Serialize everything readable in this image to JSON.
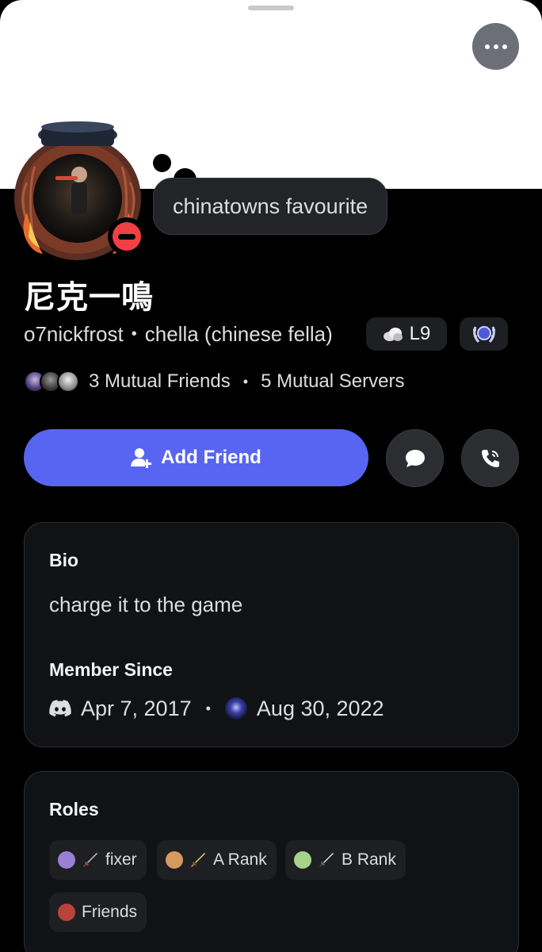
{
  "profile": {
    "display_name": "尼克一鳴",
    "username": "o7nickfrost",
    "pronouns": "chella (chinese fella)",
    "custom_status": "chinatowns favourite",
    "status": "do-not-disturb",
    "level_badge": "L9",
    "nitro_badge_icon": "laurel-icon"
  },
  "mutuals": {
    "friends_label": "3 Mutual Friends",
    "servers_label": "5 Mutual Servers"
  },
  "actions": {
    "add_friend_label": "Add Friend",
    "message_icon": "chat-bubble-icon",
    "call_icon": "phone-icon"
  },
  "bio_card": {
    "bio_title": "Bio",
    "bio_text": "charge it to the game",
    "member_since_title": "Member Since",
    "discord_since": "Apr 7, 2017",
    "server_since": "Aug 30, 2022"
  },
  "roles_card": {
    "title": "Roles",
    "roles": [
      {
        "name": "fixer",
        "color": "#9b7fd4"
      },
      {
        "name": "A Rank",
        "color": "#d49a5e"
      },
      {
        "name": "B Rank",
        "color": "#a6d28a"
      },
      {
        "name": "Friends",
        "color": "#b9433b"
      }
    ]
  },
  "colors": {
    "accent": "#5865f2",
    "dnd": "#f23f43",
    "background": "#000000",
    "card": "#111214"
  }
}
